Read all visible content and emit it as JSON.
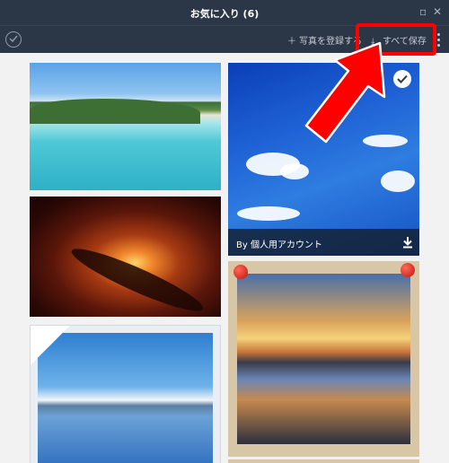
{
  "window": {
    "title": "お気に入り (6)"
  },
  "toolbar": {
    "register_label": "写真を登録する",
    "register_icon": "plus-icon",
    "save_all_label": "すべて保存",
    "save_all_icon": "download-icon"
  },
  "photos": [
    {
      "id": "beach",
      "selected": false
    },
    {
      "id": "nebula",
      "selected": false
    },
    {
      "id": "lake-mountains",
      "selected": false
    },
    {
      "id": "blue-sky-clouds",
      "selected": true,
      "caption": "By 個人用アカウント"
    },
    {
      "id": "sunset-pinned",
      "selected": false
    }
  ],
  "colors": {
    "header_bg": "#2b3646",
    "highlight": "#ff0000",
    "content_bg": "#f2f2f2"
  }
}
